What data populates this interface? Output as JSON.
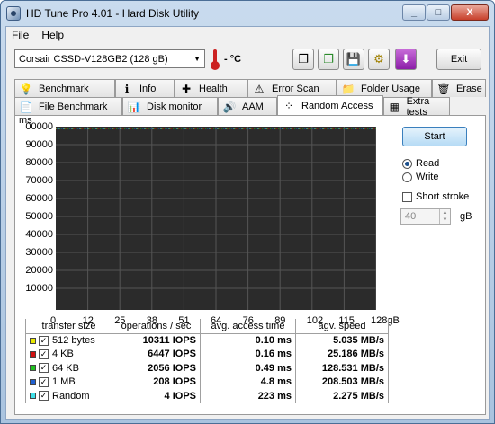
{
  "window": {
    "title": "HD Tune Pro 4.01 - Hard Disk Utility",
    "minimize": "_",
    "maximize": "□",
    "close": "X"
  },
  "menu": [
    "File",
    "Help"
  ],
  "toolbar": {
    "drive": "Corsair CSSD-V128GB2 (128 gB)",
    "temperature": "- °C",
    "exit_label": "Exit",
    "icons": [
      "copy-info-icon",
      "copy-screen-icon",
      "save-icon",
      "options-icon",
      "download-icon"
    ]
  },
  "tabs_row1": [
    {
      "label": "Benchmark",
      "icon": "benchmark-icon",
      "glyph": "💡"
    },
    {
      "label": "Info",
      "icon": "info-icon",
      "glyph": "ℹ"
    },
    {
      "label": "Health",
      "icon": "health-icon",
      "glyph": "✚"
    },
    {
      "label": "Error Scan",
      "icon": "error-scan-icon",
      "glyph": "⚠"
    },
    {
      "label": "Folder Usage",
      "icon": "folder-icon",
      "glyph": "📁"
    },
    {
      "label": "Erase",
      "icon": "erase-icon",
      "glyph": "🗑"
    }
  ],
  "tabs_row2": [
    {
      "label": "File Benchmark",
      "icon": "file-benchmark-icon",
      "glyph": "📄"
    },
    {
      "label": "Disk monitor",
      "icon": "disk-monitor-icon",
      "glyph": "📊"
    },
    {
      "label": "AAM",
      "icon": "speaker-icon",
      "glyph": "🔊"
    },
    {
      "label": "Random Access",
      "icon": "random-access-icon",
      "glyph": "⁘",
      "active": true
    },
    {
      "label": "Extra tests",
      "icon": "extra-tests-icon",
      "glyph": "▦"
    }
  ],
  "chart_data": {
    "type": "scatter",
    "ylabel": "ms",
    "yticks": [
      "00000",
      "90000",
      "80000",
      "70000",
      "60000",
      "50000",
      "40000",
      "30000",
      "20000",
      "10000"
    ],
    "xticks": [
      "0",
      "12",
      "25",
      "38",
      "51",
      "64",
      "76",
      "89",
      "102",
      "115",
      "128gB"
    ],
    "grid": true,
    "background": "#2b2b2b"
  },
  "results": {
    "headers": [
      "transfer size",
      "operations / sec",
      "avg. access time",
      "agv. speed"
    ],
    "rows": [
      {
        "size": "512 bytes",
        "color": "#e8e800",
        "ops": "10311 IOPS",
        "access": "0.10 ms",
        "speed": "5.035 MB/s"
      },
      {
        "size": "4 KB",
        "color": "#d01010",
        "ops": "6447 IOPS",
        "access": "0.16 ms",
        "speed": "25.186 MB/s"
      },
      {
        "size": "64 KB",
        "color": "#20c020",
        "ops": "2056 IOPS",
        "access": "0.49 ms",
        "speed": "128.531 MB/s"
      },
      {
        "size": "1 MB",
        "color": "#2060d0",
        "ops": "208 IOPS",
        "access": "4.8 ms",
        "speed": "208.503 MB/s"
      },
      {
        "size": "Random",
        "color": "#40e0e8",
        "ops": "4 IOPS",
        "access": "223 ms",
        "speed": "2.275 MB/s"
      }
    ]
  },
  "side": {
    "start": "Start",
    "read": "Read",
    "write": "Write",
    "short_stroke": "Short stroke",
    "stroke_value": "40",
    "unit": "gB"
  }
}
